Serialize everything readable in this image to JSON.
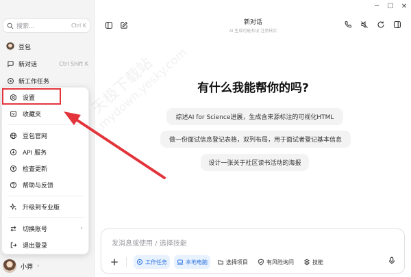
{
  "search": {
    "placeholder": "搜索...",
    "shortcut": "Ctrl K"
  },
  "sidebar": {
    "app_name": "豆包",
    "new_chat": {
      "label": "新对话",
      "shortcut": "Ctrl Shift K"
    },
    "new_task": "新工作任务"
  },
  "menu": {
    "items": [
      {
        "label": "设置",
        "icon": "gear-icon"
      },
      {
        "label": "收藏夹",
        "icon": "bookmark-icon"
      },
      {
        "label": "豆包官网",
        "icon": "globe-icon"
      },
      {
        "label": "API 服务",
        "icon": "api-icon"
      },
      {
        "label": "检查更新",
        "icon": "update-icon"
      },
      {
        "label": "帮助与反馈",
        "icon": "help-icon"
      },
      {
        "label": "升级到专业版",
        "icon": "sparkle-icon"
      },
      {
        "label": "切换账号",
        "icon": "switch-icon",
        "chevron": "›"
      },
      {
        "label": "退出登录",
        "icon": "logout-icon"
      }
    ]
  },
  "user": {
    "name": "小莽",
    "chevron": "›"
  },
  "main": {
    "title": "新对话",
    "subtitle": "AI 生成可能有误 注意核实",
    "hero": "有什么我能帮你的吗?",
    "suggestions": [
      "综述AI for Science进展，生成含来源标注的可视化HTML",
      "做一份面试信息登记表格，双列布局，用于面试者登记基本信息",
      "设计一张关于社区读书活动的海报"
    ]
  },
  "composer": {
    "placeholder": "发消息或使用 / 选择技能",
    "tools": [
      "工作任务",
      "本地电脑",
      "选择项目",
      "有风险询问",
      "技能"
    ]
  },
  "watermark": {
    "line1": "天极下载站",
    "line2": "mydown.yesky.com"
  },
  "colors": {
    "accent_blue": "#2b74e0",
    "highlight_red": "#e3343b"
  }
}
